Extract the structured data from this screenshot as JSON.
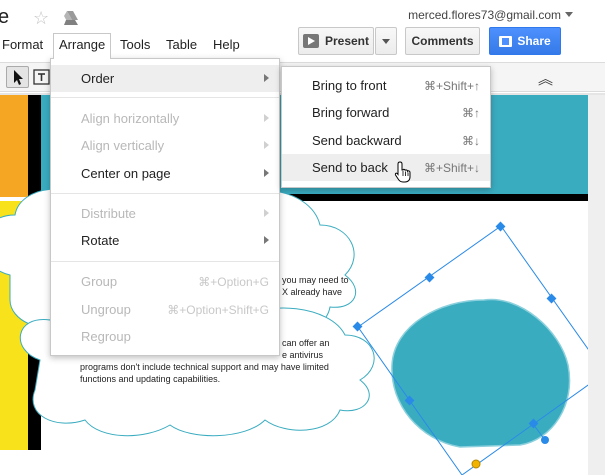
{
  "header": {
    "doc_title": "e",
    "email": "merced.flores73@gmail.com"
  },
  "menubar": {
    "items": [
      {
        "label": "Format"
      },
      {
        "label": "Arrange"
      },
      {
        "label": "Tools"
      },
      {
        "label": "Table"
      },
      {
        "label": "Help"
      }
    ]
  },
  "buttons": {
    "present": "Present",
    "comments": "Comments",
    "share": "Share"
  },
  "arrange_menu": {
    "items": [
      {
        "label": "Order",
        "submenu": true,
        "enabled": true
      },
      {
        "label": "Align horizontally",
        "submenu": true,
        "enabled": false
      },
      {
        "label": "Align vertically",
        "submenu": true,
        "enabled": false
      },
      {
        "label": "Center on page",
        "submenu": true,
        "enabled": true
      },
      {
        "label": "Distribute",
        "submenu": true,
        "enabled": false
      },
      {
        "label": "Rotate",
        "submenu": true,
        "enabled": true
      },
      {
        "label": "Group",
        "shortcut": "⌘+Option+G",
        "enabled": false
      },
      {
        "label": "Ungroup",
        "shortcut": "⌘+Option+Shift+G",
        "enabled": false
      },
      {
        "label": "Regroup",
        "enabled": false
      }
    ]
  },
  "order_submenu": {
    "items": [
      {
        "label": "Bring to front",
        "shortcut": "⌘+Shift+↑"
      },
      {
        "label": "Bring forward",
        "shortcut": "⌘↑"
      },
      {
        "label": "Send backward",
        "shortcut": "⌘↓"
      },
      {
        "label": "Send to back",
        "shortcut": "⌘+Shift+↓"
      }
    ]
  },
  "slide": {
    "text_fragments": [
      "you may need to",
      "X already have",
      "can offer an",
      "e antivirus",
      "programs don't include technical support and may have limited",
      "functions and updating capabilities."
    ]
  },
  "colors": {
    "teal": "#3aacc0",
    "orange": "#f5a623",
    "yellow": "#f7e21b",
    "selection": "#2a8ae8",
    "share_blue": "#4d90fe"
  }
}
